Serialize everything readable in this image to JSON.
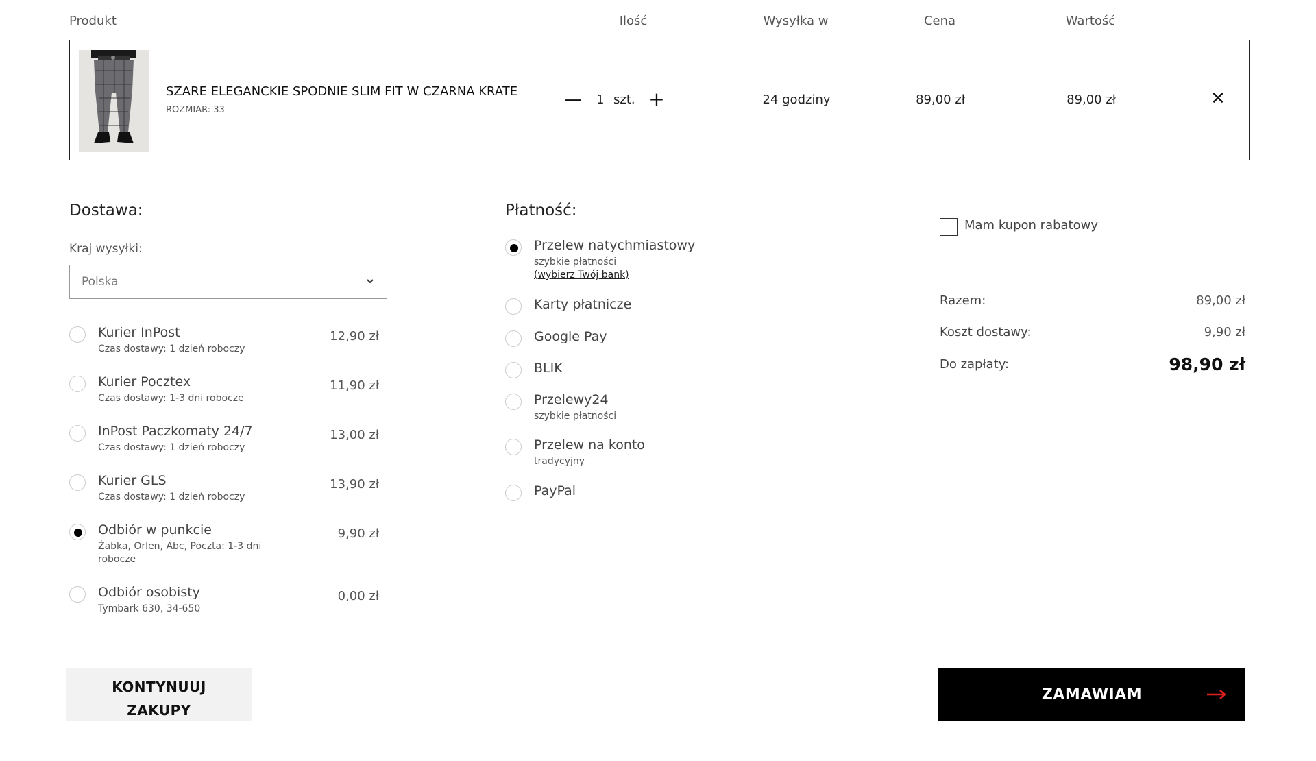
{
  "cart_header": {
    "product": "Produkt",
    "quantity": "Ilość",
    "shipping": "Wysyłka w",
    "price": "Cena",
    "value": "Wartość"
  },
  "cart_item": {
    "name": "SZARE ELEGANCKIE SPODNIE SLIM FIT W CZARNA KRATE",
    "size": "ROZMIAR: 33",
    "quantity": "1",
    "unit": "szt.",
    "shipping_time": "24 godziny",
    "price": "89,00 zł",
    "value": "89,00 zł",
    "minus": "—",
    "plus": "+",
    "remove": "✕"
  },
  "delivery": {
    "title": "Dostawa:",
    "country_label": "Kraj wysyłki:",
    "country_value": "Polska",
    "options": [
      {
        "name": "Kurier InPost",
        "sub": "Czas dostawy: 1 dzień roboczy",
        "price": "12,90 zł",
        "selected": false
      },
      {
        "name": "Kurier Pocztex",
        "sub": "Czas dostawy: 1-3 dni robocze",
        "price": "11,90 zł",
        "selected": false
      },
      {
        "name": "InPost Paczkomaty 24/7",
        "sub": "Czas dostawy: 1 dzień roboczy",
        "price": "13,00 zł",
        "selected": false
      },
      {
        "name": "Kurier GLS",
        "sub": "Czas dostawy: 1 dzień roboczy",
        "price": "13,90 zł",
        "selected": false
      },
      {
        "name": "Odbiór w punkcie",
        "sub": "Żabka, Orlen, Abc, Poczta: 1-3 dni robocze",
        "price": "9,90 zł",
        "selected": true
      },
      {
        "name": "Odbiór osobisty",
        "sub": "Tymbark 630, 34-650",
        "price": "0,00 zł",
        "selected": false
      }
    ]
  },
  "payment": {
    "title": "Płatność:",
    "options": [
      {
        "name": "Przelew natychmiastowy",
        "sub": "szybkie płatności",
        "link": "(wybierz Twój bank)",
        "selected": true
      },
      {
        "name": "Karty płatnicze",
        "sub": "",
        "selected": false
      },
      {
        "name": "Google Pay",
        "sub": "",
        "selected": false
      },
      {
        "name": "BLIK",
        "sub": "",
        "selected": false
      },
      {
        "name": "Przelewy24",
        "sub": "szybkie płatności",
        "selected": false
      },
      {
        "name": "Przelew na konto",
        "sub": "tradycyjny",
        "selected": false
      },
      {
        "name": "PayPal",
        "sub": "",
        "selected": false
      }
    ]
  },
  "coupon": {
    "label": "Mam kupon rabatowy",
    "checked": false
  },
  "summary": {
    "subtotal_label": "Razem:",
    "subtotal_value": "89,00 zł",
    "shipping_label": "Koszt dostawy:",
    "shipping_value": "9,90 zł",
    "total_label": "Do zapłaty:",
    "total_value": "98,90 zł"
  },
  "buttons": {
    "continue_line1": "KONTYNUUJ",
    "continue_line2": "ZAKUPY",
    "order": "ZAMAWIAM"
  },
  "icons": {
    "remove": "close-icon",
    "select": "chevron-down-icon",
    "order_arrow": "arrow-right-icon"
  },
  "colors": {
    "accent": "#e02020",
    "primary_button": "#000000",
    "secondary_button": "#f2f2f2"
  }
}
